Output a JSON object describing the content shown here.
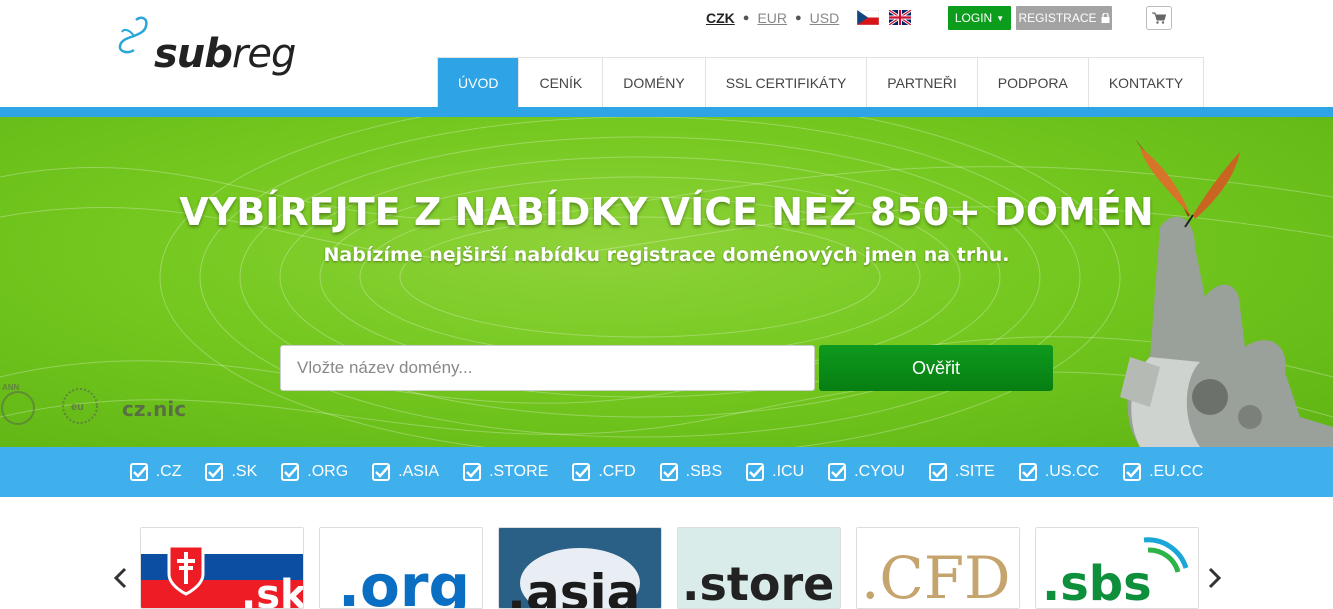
{
  "logo": {
    "text_a": "sub",
    "text_b": "reg"
  },
  "currency": {
    "items": [
      "CZK",
      "EUR",
      "USD"
    ],
    "active": "CZK"
  },
  "languages": [
    "cs",
    "en"
  ],
  "auth": {
    "login": "LOGIN",
    "register": "REGISTRACE"
  },
  "nav": {
    "tabs": [
      "ÚVOD",
      "CENÍK",
      "DOMÉNY",
      "SSL CERTIFIKÁTY",
      "PARTNEŘI",
      "PODPORA",
      "KONTAKTY"
    ],
    "active": "ÚVOD"
  },
  "hero": {
    "title": "VYBÍREJTE Z NABÍDKY VÍCE NEŽ 850+ DOMÉN",
    "subtitle": "Nabízíme nejširší nabídku registrace doménových jmen na trhu.",
    "search_placeholder": "Vložte název domény...",
    "verify_label": "Ověřit",
    "partners": {
      "icann": "ANN",
      "eu": "eu",
      "cznic": "cz.nic"
    }
  },
  "tlds": [
    ".CZ",
    ".SK",
    ".ORG",
    ".ASIA",
    ".STORE",
    ".CFD",
    ".SBS",
    ".ICU",
    ".CYOU",
    ".SITE",
    ".US.CC",
    ".EU.CC"
  ],
  "carousel": {
    "cards": [
      ".sk",
      ".org",
      ".asia",
      ".store",
      ".CFD",
      ".sbs"
    ]
  },
  "colors": {
    "brand_blue": "#2ea3e6",
    "tld_bar": "#3fb0ec",
    "hero_green": "#74c81f",
    "button_green": "#0d9d1c",
    "register_gray": "#a3a3a3"
  }
}
